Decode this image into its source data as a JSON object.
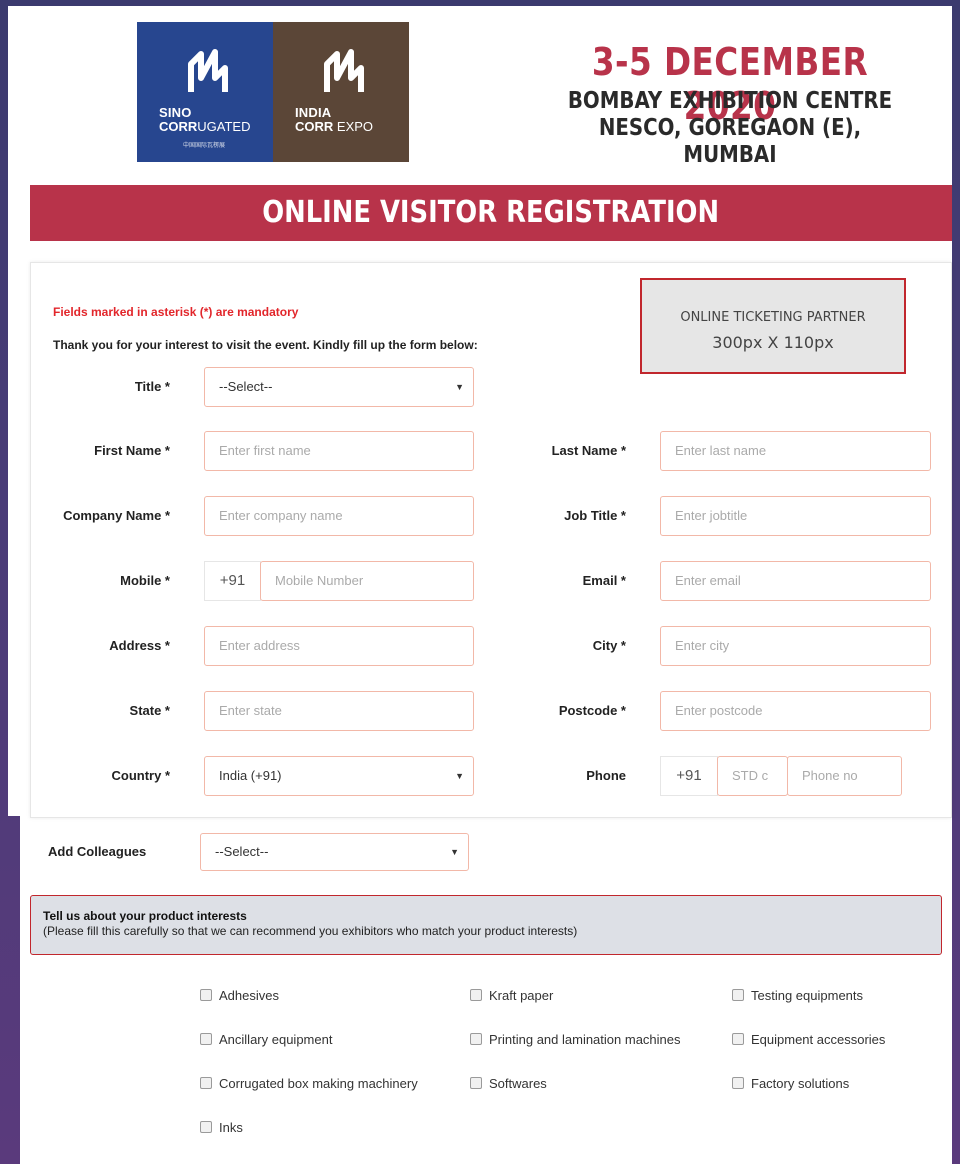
{
  "header": {
    "logo_sino": {
      "line1": "SINO",
      "line2_bold": "CORR",
      "line2_rest": "UGATED",
      "line3": "中国国际瓦楞展"
    },
    "logo_india": {
      "line1": "INDIA",
      "line2_bold": "CORR",
      "line2_rest": " EXPO"
    },
    "date": "3-5 DECEMBER 2020",
    "venue_line1": "BOMBAY EXHIBITION CENTRE",
    "venue_line2": "NESCO, GOREGAON (E), MUMBAI"
  },
  "banner": {
    "title": "ONLINE VISITOR REGISTRATION"
  },
  "form": {
    "mandatory_note": "Fields marked in asterisk (*) are mandatory",
    "intro": "Thank you for your interest to visit the event. Kindly fill up the form below:",
    "partner": {
      "line1": "ONLINE TICKETING PARTNER",
      "line2": "300px X 110px"
    },
    "title": {
      "label": "Title *",
      "value": "--Select--"
    },
    "first_name": {
      "label": "First Name *",
      "placeholder": "Enter first name"
    },
    "last_name": {
      "label": "Last Name *",
      "placeholder": "Enter last name"
    },
    "company": {
      "label": "Company Name *",
      "placeholder": "Enter company name"
    },
    "job_title": {
      "label": "Job Title *",
      "placeholder": "Enter jobtitle"
    },
    "mobile": {
      "label": "Mobile *",
      "prefix": "+91",
      "placeholder": "Mobile Number"
    },
    "email": {
      "label": "Email *",
      "placeholder": "Enter email"
    },
    "address": {
      "label": "Address *",
      "placeholder": "Enter address"
    },
    "city": {
      "label": "City *",
      "placeholder": "Enter city"
    },
    "state": {
      "label": "State *",
      "placeholder": "Enter state"
    },
    "postcode": {
      "label": "Postcode *",
      "placeholder": "Enter postcode"
    },
    "country": {
      "label": "Country *",
      "value": "India (+91)"
    },
    "phone": {
      "label": "Phone",
      "prefix": "+91",
      "std_placeholder": "STD c",
      "placeholder": "Phone no"
    }
  },
  "colleagues": {
    "label": "Add Colleagues",
    "value": "--Select--"
  },
  "interests": {
    "title": "Tell us about your product interests",
    "subtitle": "(Please fill this carefully so that we can recommend you exhibitors who match your product interests)",
    "options": [
      "Adhesives",
      "Kraft paper",
      "Testing equipments",
      "Ancillary equipment",
      "Printing and lamination machines",
      "Equipment accessories",
      "Corrugated box making machinery",
      "Softwares",
      "Factory solutions",
      "Inks"
    ]
  },
  "colors": {
    "brand_red": "#b8334a",
    "sino_blue": "#27468f",
    "india_brown": "#5b4637",
    "mandatory_red": "#e2262b"
  }
}
